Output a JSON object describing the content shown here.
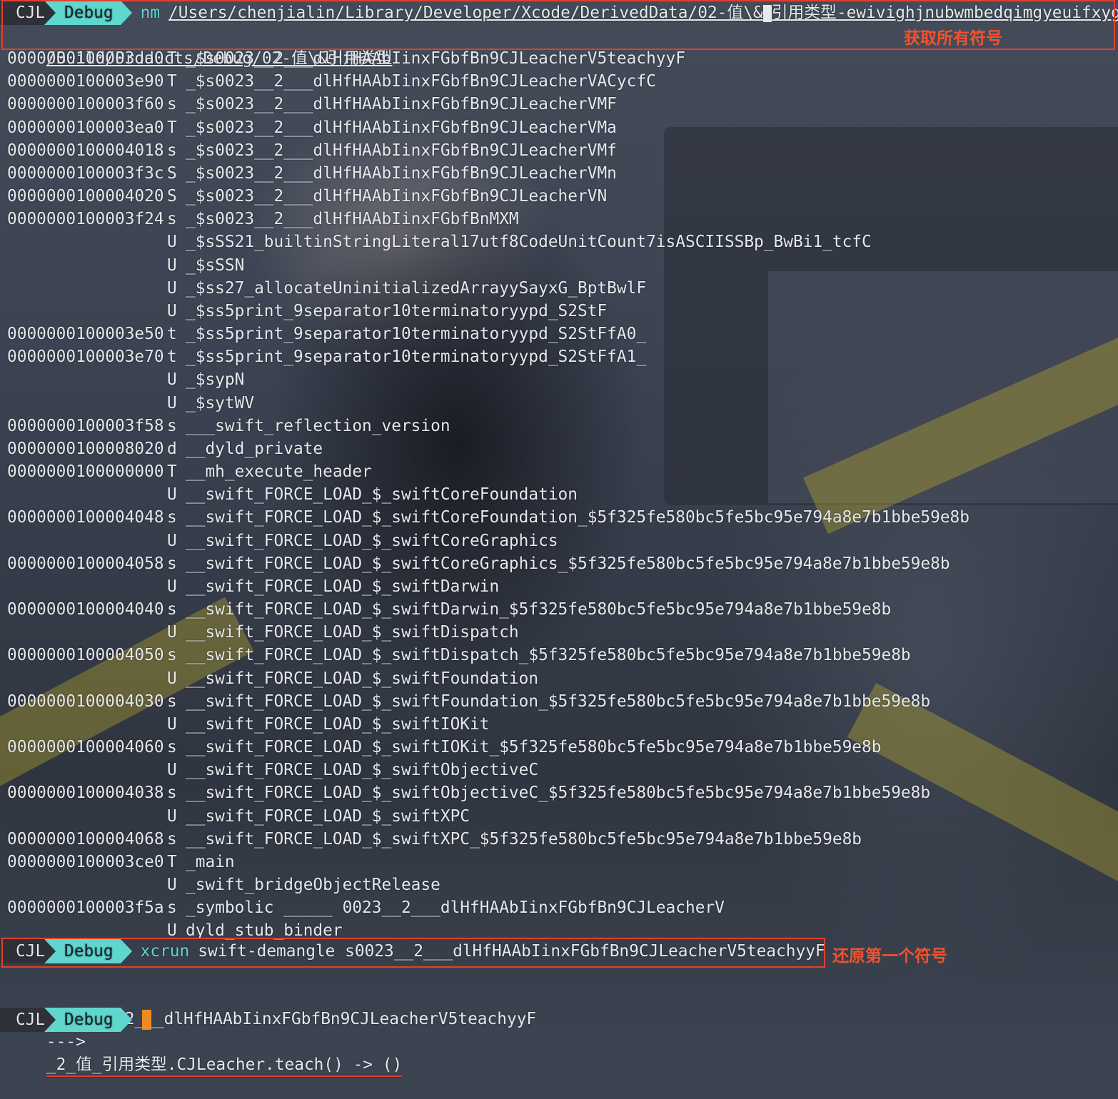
{
  "prompt": {
    "user": "CJL",
    "dir": "Debug"
  },
  "nm_command": {
    "cmd": "nm",
    "path_line1": "/Users/chenjialin/Library/Developer/Xcode/DerivedData/02-值\\&",
    "path_line1_after_cursor": "引用类型-ewivighjnubwmbedqimgyeuifxyg",
    "path_line2": "/Build/Products/Debug/02-值\\&引用类型"
  },
  "annotations": {
    "get_symbols": "获取所有符号",
    "restore_first": "还原第一个符号"
  },
  "symbols": [
    {
      "addr": "0000000100003da0",
      "type": "T",
      "name": "_$s0023__2___dlHfHAAbIinxFGbfBn9CJLeacherV5teachyyF"
    },
    {
      "addr": "0000000100003e90",
      "type": "T",
      "name": "_$s0023__2___dlHfHAAbIinxFGbfBn9CJLeacherVACycfC"
    },
    {
      "addr": "0000000100003f60",
      "type": "s",
      "name": "_$s0023__2___dlHfHAAbIinxFGbfBn9CJLeacherVMF"
    },
    {
      "addr": "0000000100003ea0",
      "type": "T",
      "name": "_$s0023__2___dlHfHAAbIinxFGbfBn9CJLeacherVMa"
    },
    {
      "addr": "0000000100004018",
      "type": "s",
      "name": "_$s0023__2___dlHfHAAbIinxFGbfBn9CJLeacherVMf"
    },
    {
      "addr": "0000000100003f3c",
      "type": "S",
      "name": "_$s0023__2___dlHfHAAbIinxFGbfBn9CJLeacherVMn"
    },
    {
      "addr": "0000000100004020",
      "type": "S",
      "name": "_$s0023__2___dlHfHAAbIinxFGbfBn9CJLeacherVN"
    },
    {
      "addr": "0000000100003f24",
      "type": "s",
      "name": "_$s0023__2___dlHfHAAbIinxFGbfBnMXM"
    },
    {
      "addr": "",
      "type": "U",
      "name": "_$sSS21_builtinStringLiteral17utf8CodeUnitCount7isASCIISSBp_BwBi1_tcfC"
    },
    {
      "addr": "",
      "type": "U",
      "name": "_$sSSN"
    },
    {
      "addr": "",
      "type": "U",
      "name": "_$ss27_allocateUninitializedArrayySayxG_BptBwlF"
    },
    {
      "addr": "",
      "type": "U",
      "name": "_$ss5print_9separator10terminatoryypd_S2StF"
    },
    {
      "addr": "0000000100003e50",
      "type": "t",
      "name": "_$ss5print_9separator10terminatoryypd_S2StFfA0_"
    },
    {
      "addr": "0000000100003e70",
      "type": "t",
      "name": "_$ss5print_9separator10terminatoryypd_S2StFfA1_"
    },
    {
      "addr": "",
      "type": "U",
      "name": "_$sypN"
    },
    {
      "addr": "",
      "type": "U",
      "name": "_$sytWV"
    },
    {
      "addr": "0000000100003f58",
      "type": "s",
      "name": "___swift_reflection_version"
    },
    {
      "addr": "0000000100008020",
      "type": "d",
      "name": "__dyld_private"
    },
    {
      "addr": "0000000100000000",
      "type": "T",
      "name": "__mh_execute_header"
    },
    {
      "addr": "",
      "type": "U",
      "name": "__swift_FORCE_LOAD_$_swiftCoreFoundation"
    },
    {
      "addr": "0000000100004048",
      "type": "s",
      "name": "__swift_FORCE_LOAD_$_swiftCoreFoundation_$5f325fe580bc5fe5bc95e794a8e7b1bbe59e8b"
    },
    {
      "addr": "",
      "type": "U",
      "name": "__swift_FORCE_LOAD_$_swiftCoreGraphics"
    },
    {
      "addr": "0000000100004058",
      "type": "s",
      "name": "__swift_FORCE_LOAD_$_swiftCoreGraphics_$5f325fe580bc5fe5bc95e794a8e7b1bbe59e8b"
    },
    {
      "addr": "",
      "type": "U",
      "name": "__swift_FORCE_LOAD_$_swiftDarwin"
    },
    {
      "addr": "0000000100004040",
      "type": "s",
      "name": "__swift_FORCE_LOAD_$_swiftDarwin_$5f325fe580bc5fe5bc95e794a8e7b1bbe59e8b"
    },
    {
      "addr": "",
      "type": "U",
      "name": "__swift_FORCE_LOAD_$_swiftDispatch"
    },
    {
      "addr": "0000000100004050",
      "type": "s",
      "name": "__swift_FORCE_LOAD_$_swiftDispatch_$5f325fe580bc5fe5bc95e794a8e7b1bbe59e8b"
    },
    {
      "addr": "",
      "type": "U",
      "name": "__swift_FORCE_LOAD_$_swiftFoundation"
    },
    {
      "addr": "0000000100004030",
      "type": "s",
      "name": "__swift_FORCE_LOAD_$_swiftFoundation_$5f325fe580bc5fe5bc95e794a8e7b1bbe59e8b"
    },
    {
      "addr": "",
      "type": "U",
      "name": "__swift_FORCE_LOAD_$_swiftIOKit"
    },
    {
      "addr": "0000000100004060",
      "type": "s",
      "name": "__swift_FORCE_LOAD_$_swiftIOKit_$5f325fe580bc5fe5bc95e794a8e7b1bbe59e8b"
    },
    {
      "addr": "",
      "type": "U",
      "name": "__swift_FORCE_LOAD_$_swiftObjectiveC"
    },
    {
      "addr": "0000000100004038",
      "type": "s",
      "name": "__swift_FORCE_LOAD_$_swiftObjectiveC_$5f325fe580bc5fe5bc95e794a8e7b1bbe59e8b"
    },
    {
      "addr": "",
      "type": "U",
      "name": "__swift_FORCE_LOAD_$_swiftXPC"
    },
    {
      "addr": "0000000100004068",
      "type": "s",
      "name": "__swift_FORCE_LOAD_$_swiftXPC_$5f325fe580bc5fe5bc95e794a8e7b1bbe59e8b"
    },
    {
      "addr": "0000000100003ce0",
      "type": "T",
      "name": "_main"
    },
    {
      "addr": "",
      "type": "U",
      "name": "_swift_bridgeObjectRelease"
    },
    {
      "addr": "0000000100003f5a",
      "type": "s",
      "name": "_symbolic _____ 0023__2___dlHfHAAbIinxFGbfBn9CJLeacherV"
    },
    {
      "addr": "",
      "type": "U",
      "name": "dyld_stub_binder"
    }
  ],
  "demangle_command": {
    "cmd": "xcrun",
    "args": "swift-demangle s0023__2___dlHfHAAbIinxFGbfBn9CJLeacherV5teachyyF"
  },
  "demangle_output": {
    "mangled": "$s0023__2___dlHfHAAbIinxFGbfBn9CJLeacherV5teachyyF",
    "arrow": "--->",
    "demangled": "_2_值_引用类型.CJLeacher.teach() -> ()"
  },
  "colors": {
    "prompt_dir_bg": "#5fd7cf",
    "prompt_host_bg": "#2f3138",
    "command_color": "#5fd7cf",
    "annotation_red": "#e2402a",
    "cursor_orange": "#f08a24"
  }
}
